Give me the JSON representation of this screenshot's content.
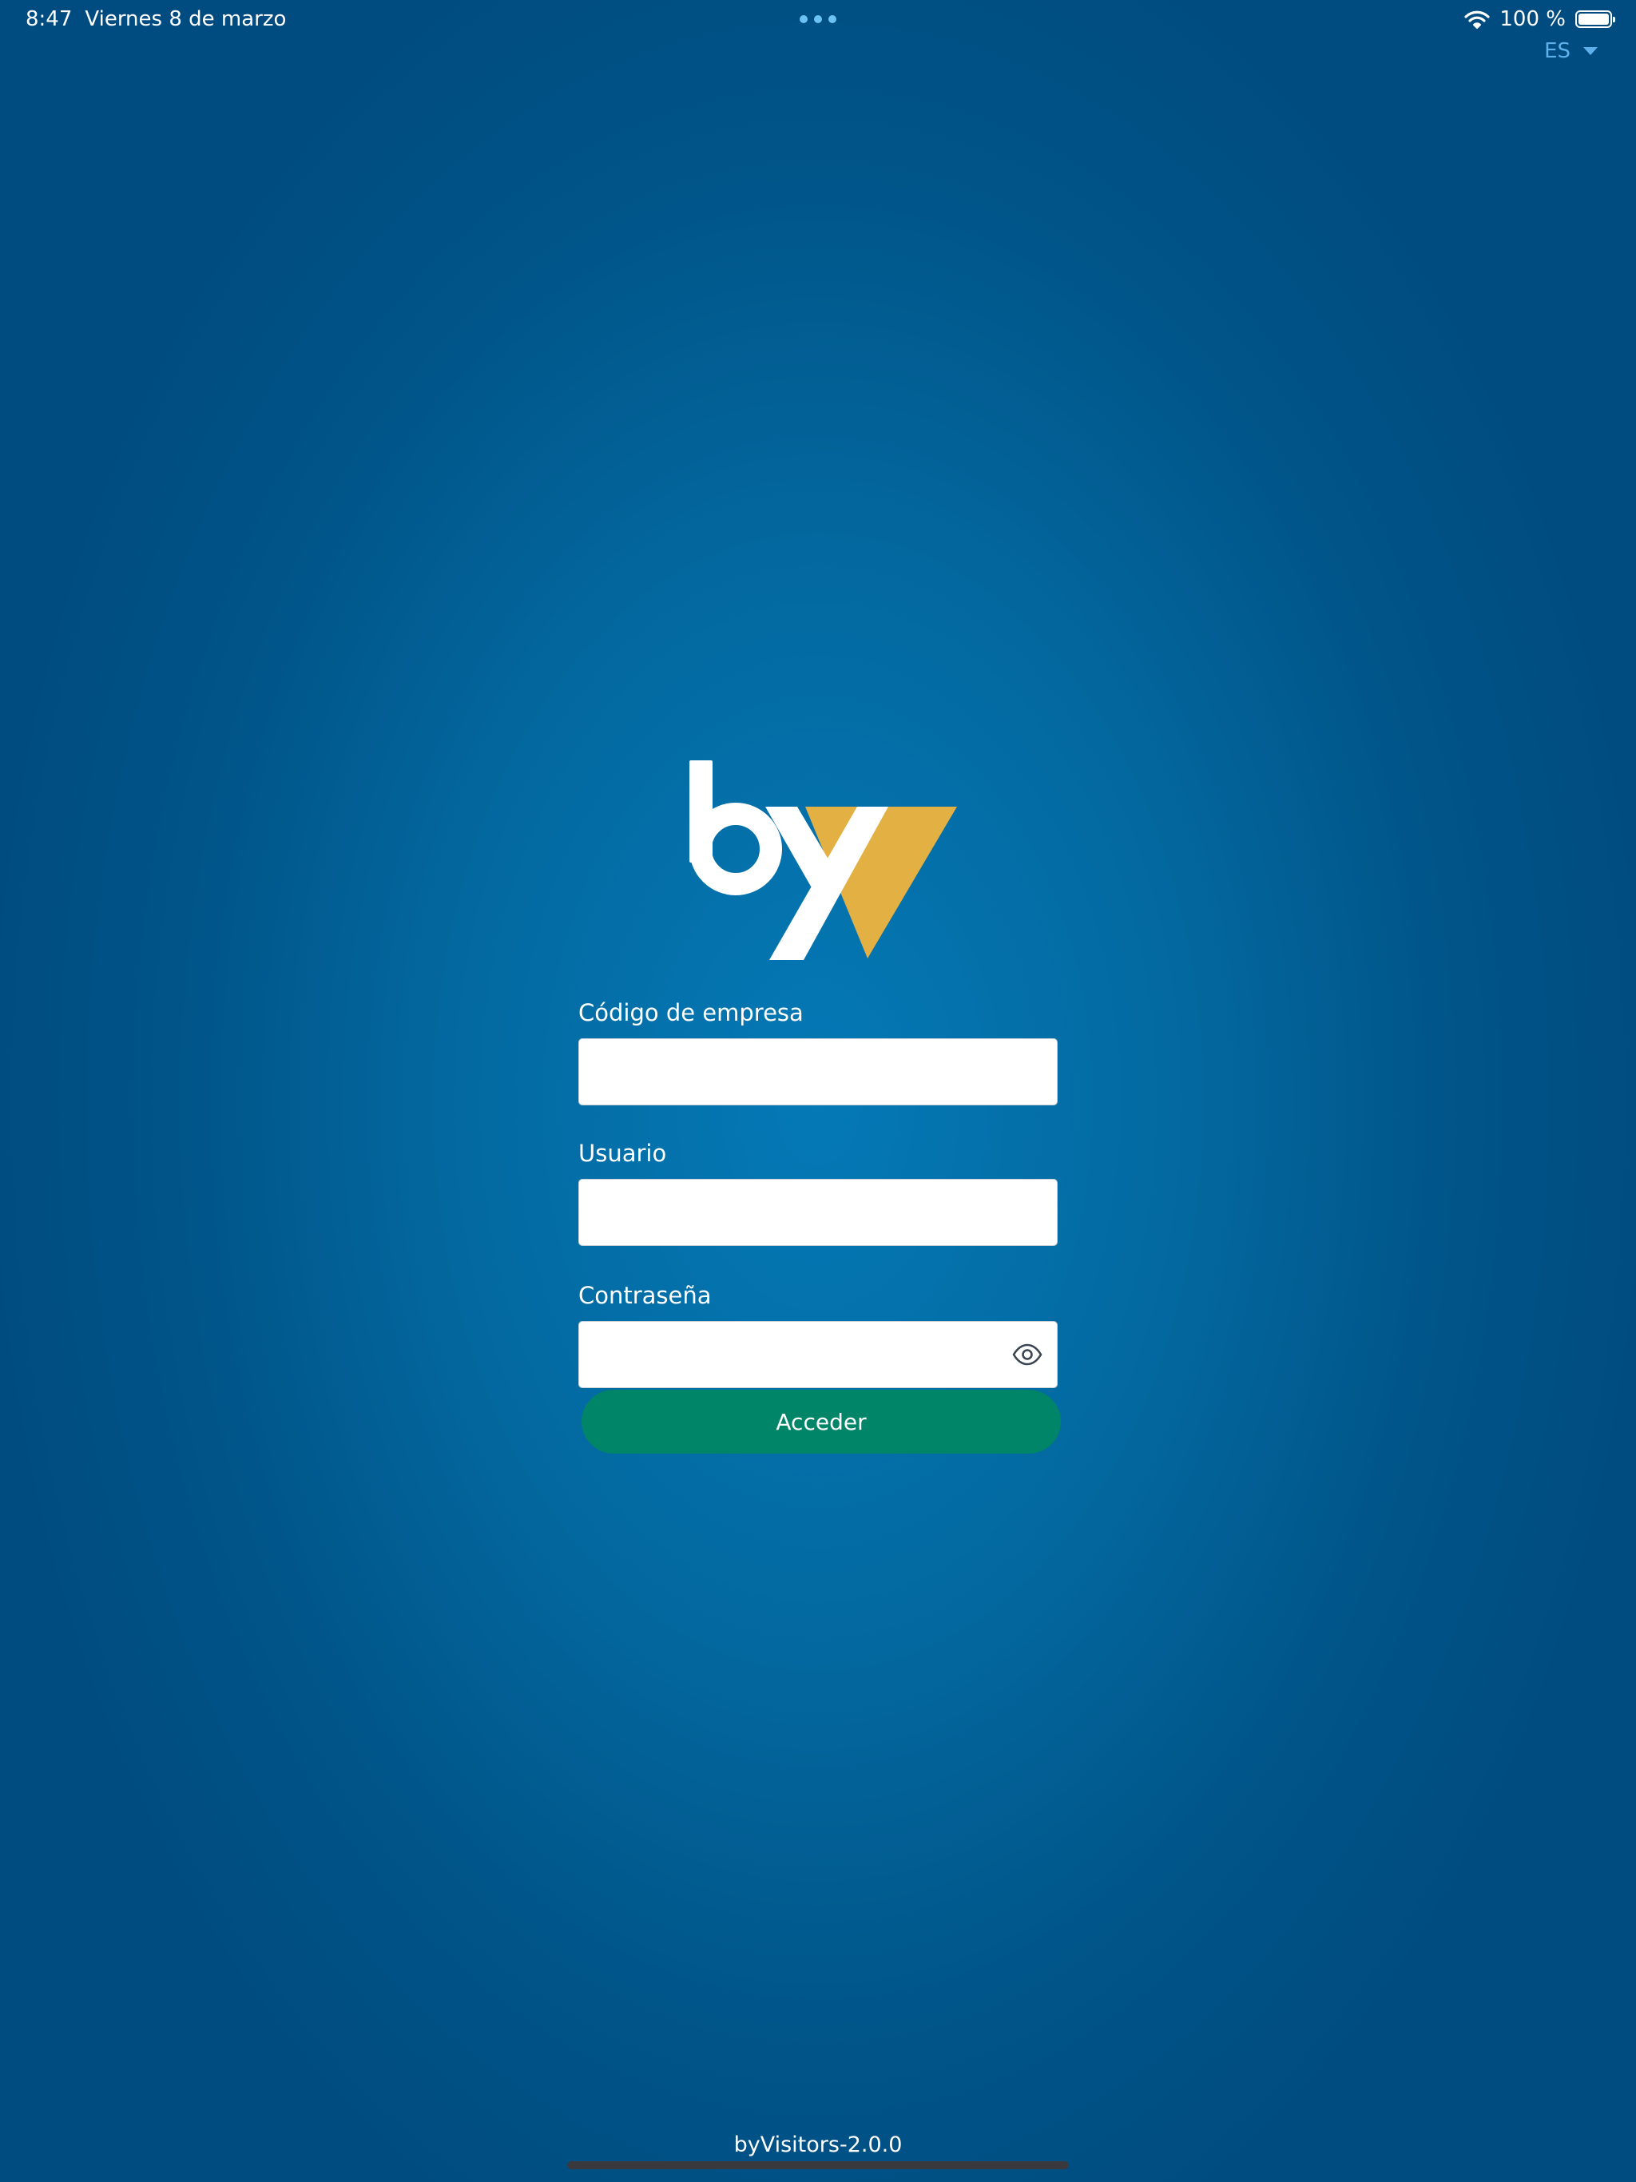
{
  "status_bar": {
    "time": "8:47",
    "date": "Viernes 8 de marzo",
    "battery": "100 %",
    "battery_level": 1.0
  },
  "language": {
    "selected": "ES"
  },
  "logo": {
    "text": "by",
    "colors": {
      "letters": "#ffffff",
      "accent": "#e3b043"
    }
  },
  "form": {
    "company_code": {
      "label": "Código de empresa",
      "value": "",
      "placeholder": ""
    },
    "user": {
      "label": "Usuario",
      "value": "",
      "placeholder": ""
    },
    "password": {
      "label": "Contraseña",
      "value": "",
      "placeholder": ""
    },
    "submit_label": "Acceder"
  },
  "footer": {
    "version": "byVisitors-2.0.0"
  },
  "colors": {
    "background_center": "#0479b6",
    "background_edge": "#004c80",
    "button": "#008569",
    "language": "#5db0ea"
  },
  "icons": {
    "wifi": "wifi-icon",
    "battery": "battery-icon",
    "language_caret": "chevron-down-icon",
    "password_toggle": "eye-icon",
    "multitask": "more-dots-icon"
  }
}
